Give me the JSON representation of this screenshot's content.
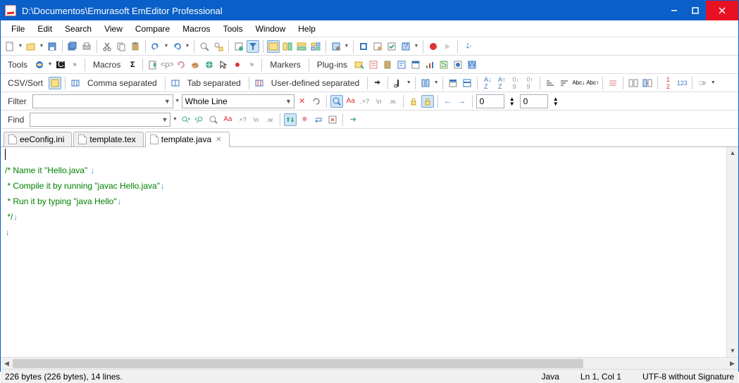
{
  "title": "D:\\Documentos\\Emurasoft EmEditor Professional",
  "menu": [
    "File",
    "Edit",
    "Search",
    "View",
    "Compare",
    "Macros",
    "Tools",
    "Window",
    "Help"
  ],
  "row2": {
    "tools": "Tools",
    "macros": "Macros",
    "markers": "Markers",
    "plugins": "Plug-ins"
  },
  "row3": {
    "csvsort": "CSV/Sort",
    "comma": "Comma separated",
    "tab": "Tab separated",
    "user": "User-defined separated"
  },
  "row4": {
    "filter": "Filter",
    "wholeline": "Whole Line"
  },
  "row5": {
    "find": "Find"
  },
  "spin": {
    "v1": "0",
    "v2": "0"
  },
  "tabs": [
    {
      "label": "eeConfig.ini",
      "active": false,
      "closable": false
    },
    {
      "label": "template.tex",
      "active": false,
      "closable": false
    },
    {
      "label": "template.java",
      "active": true,
      "closable": true
    }
  ],
  "code": {
    "l1": "/* Name it \"Hello.java\" ",
    "l2": " * Compile it by running \"javac Hello.java\"",
    "l3": " * Run it by typing \"java Hello\"",
    "l4": " */"
  },
  "status": {
    "left": "226 bytes (226 bytes), 14 lines.",
    "lang": "Java",
    "pos": "Ln 1, Col 1",
    "enc": "UTF-8 without Signature"
  }
}
